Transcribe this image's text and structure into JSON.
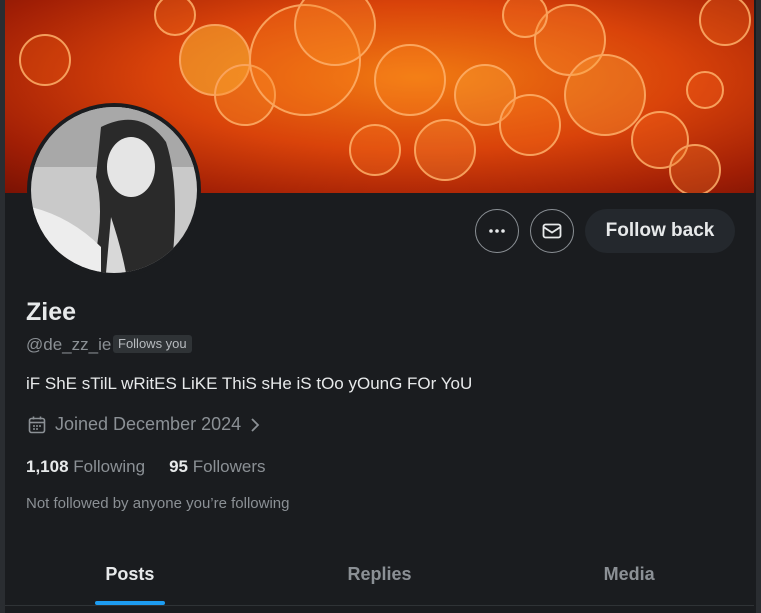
{
  "profile": {
    "name": "Ziee",
    "handle": "@de_zz_ie",
    "follows_you_badge": "Follows you",
    "bio": "iF ShE sTilL wRitES LiKE ThiS sHe iS tOo yOunG FOr YoU",
    "joined": "Joined December 2024",
    "following_count": "1,108",
    "following_label": "Following",
    "followers_count": "95",
    "followers_label": "Followers",
    "not_followed_text": "Not followed by anyone you’re following"
  },
  "actions": {
    "more_icon": "more-horizontal-icon",
    "message_icon": "envelope-icon",
    "follow_back_label": "Follow back"
  },
  "tabs": [
    {
      "label": "Posts",
      "active": true
    },
    {
      "label": "Replies",
      "active": false
    },
    {
      "label": "Media",
      "active": false
    }
  ],
  "colors": {
    "background": "#1a1c1f",
    "accent": "#1d9bf0",
    "muted_text": "#8b9095",
    "banner_orange": "#f07a12"
  }
}
